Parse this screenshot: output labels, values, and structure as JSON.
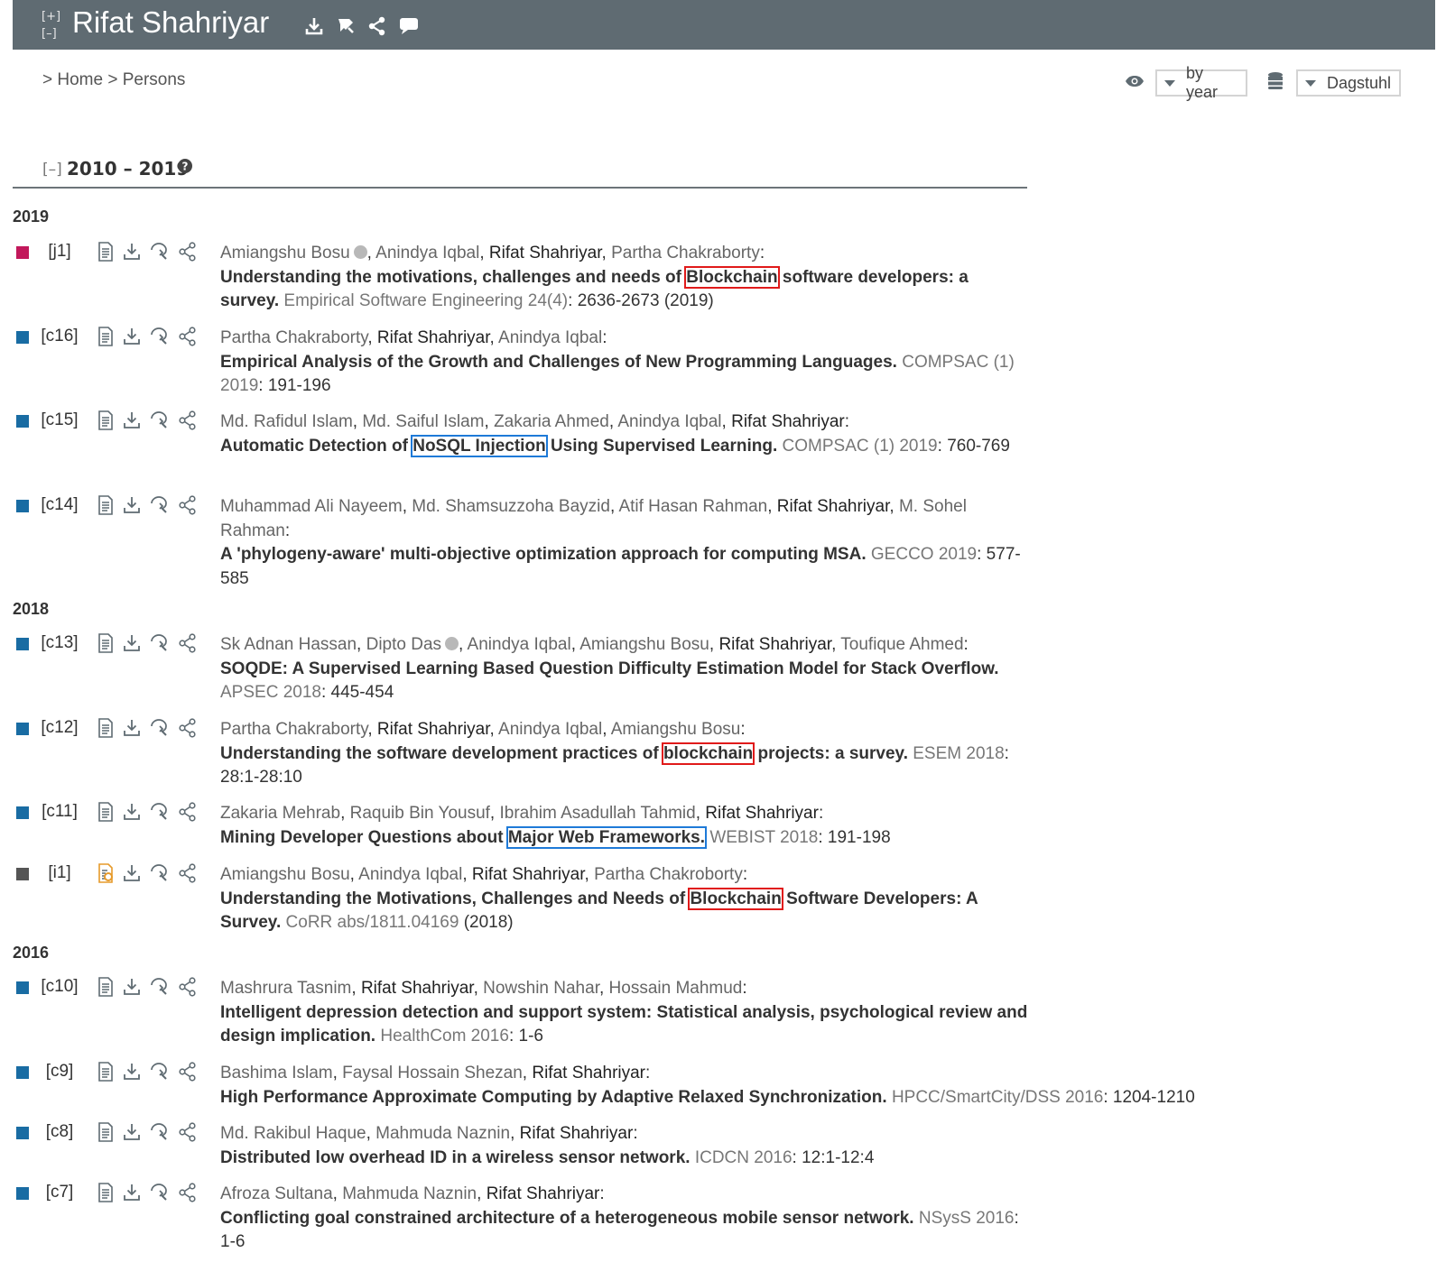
{
  "header": {
    "expand_label": "[+]",
    "collapse_label": "[–]",
    "title": "Rifat Shahriyar",
    "bg_color": "#5f6b72"
  },
  "breadcrumb": {
    "text": "> Home > Persons"
  },
  "controls": {
    "view_mode": "by year",
    "mirror": "Dagstuhl"
  },
  "section": {
    "toggle": "[–]",
    "label": "2010 – 2019"
  },
  "venue_colors": {
    "journal": "#c2185b",
    "conference": "#196ca3",
    "informal": "#555555"
  },
  "years": [
    {
      "year": "2019",
      "entries": [
        {
          "key": "[j1]",
          "type": "journal",
          "authors": [
            {
              "name": "Amiangshu Bosu",
              "me": false,
              "orcid": true
            },
            {
              "name": "Anindya Iqbal",
              "me": false
            },
            {
              "name": "Rifat Shahriyar",
              "me": true
            },
            {
              "name": "Partha Chakraborty",
              "me": false
            }
          ],
          "title_pre": "Understanding the motivations, challenges and needs of ",
          "title_hl": "Blockchain",
          "hl": "red",
          "title_post": " software developers: a survey.",
          "venue": "Empirical Software Engineering 24(4)",
          "pages": ": 2636-2673 (2019)"
        },
        {
          "key": "[c16]",
          "type": "conference",
          "authors": [
            {
              "name": "Partha Chakraborty",
              "me": false
            },
            {
              "name": "Rifat Shahriyar",
              "me": true
            },
            {
              "name": "Anindya Iqbal",
              "me": false
            }
          ],
          "title_pre": "Empirical Analysis of the Growth and Challenges of New Programming Languages.",
          "title_hl": "",
          "hl": "",
          "title_post": "",
          "venue": "COMPSAC (1) 2019",
          "pages": ": 191-196"
        },
        {
          "key": "[c15]",
          "type": "conference",
          "authors": [
            {
              "name": "Md. Rafidul Islam",
              "me": false
            },
            {
              "name": "Md. Saiful Islam",
              "me": false
            },
            {
              "name": "Zakaria Ahmed",
              "me": false
            },
            {
              "name": "Anindya Iqbal",
              "me": false
            },
            {
              "name": "Rifat Shahriyar",
              "me": true
            }
          ],
          "title_pre": "Automatic Detection of ",
          "title_hl": "NoSQL Injection",
          "hl": "blue",
          "title_post": " Using Supervised Learning.",
          "venue": "COMPSAC (1) 2019",
          "pages": ": 760-769"
        },
        {
          "key": "[c14]",
          "type": "conference",
          "authors": [
            {
              "name": "Muhammad Ali Nayeem",
              "me": false
            },
            {
              "name": "Md. Shamsuzzoha Bayzid",
              "me": false
            },
            {
              "name": "Atif Hasan Rahman",
              "me": false
            },
            {
              "name": "Rifat Shahriyar",
              "me": true
            },
            {
              "name": "M. Sohel Rahman",
              "me": false
            }
          ],
          "title_pre": "A 'phylogeny-aware' multi-objective optimization approach for computing MSA.",
          "title_hl": "",
          "hl": "",
          "title_post": "",
          "venue": "GECCO 2019",
          "pages": ": 577-585"
        }
      ]
    },
    {
      "year": "2018",
      "entries": [
        {
          "key": "[c13]",
          "type": "conference",
          "authors": [
            {
              "name": "Sk Adnan Hassan",
              "me": false
            },
            {
              "name": "Dipto Das",
              "me": false,
              "orcid": true
            },
            {
              "name": "Anindya Iqbal",
              "me": false
            },
            {
              "name": "Amiangshu Bosu",
              "me": false
            },
            {
              "name": "Rifat Shahriyar",
              "me": true
            },
            {
              "name": "Toufique Ahmed",
              "me": false
            }
          ],
          "title_pre": "SOQDE: A Supervised Learning Based Question Difficulty Estimation Model for Stack Overflow.",
          "title_hl": "",
          "hl": "",
          "title_post": "",
          "venue": "APSEC 2018",
          "pages": ": 445-454"
        },
        {
          "key": "[c12]",
          "type": "conference",
          "authors": [
            {
              "name": "Partha Chakraborty",
              "me": false
            },
            {
              "name": "Rifat Shahriyar",
              "me": true
            },
            {
              "name": "Anindya Iqbal",
              "me": false
            },
            {
              "name": "Amiangshu Bosu",
              "me": false
            }
          ],
          "title_pre": "Understanding the software development practices of ",
          "title_hl": "blockchain",
          "hl": "red",
          "title_post": " projects: a survey.",
          "venue": "ESEM 2018",
          "pages": ": 28:1-28:10"
        },
        {
          "key": "[c11]",
          "type": "conference",
          "authors": [
            {
              "name": "Zakaria Mehrab",
              "me": false
            },
            {
              "name": "Raquib Bin Yousuf",
              "me": false
            },
            {
              "name": "Ibrahim Asadullah Tahmid",
              "me": false
            },
            {
              "name": "Rifat Shahriyar",
              "me": true
            }
          ],
          "title_pre": "Mining Developer Questions about ",
          "title_hl": "Major Web Frameworks.",
          "hl": "blue",
          "title_post": "",
          "venue": "WEBIST 2018",
          "pages": ": 191-198"
        },
        {
          "key": "[i1]",
          "type": "informal",
          "authors": [
            {
              "name": "Amiangshu Bosu",
              "me": false
            },
            {
              "name": "Anindya Iqbal",
              "me": false
            },
            {
              "name": "Rifat Shahriyar",
              "me": true
            },
            {
              "name": "Partha Chakroborty",
              "me": false
            }
          ],
          "title_pre": "Understanding the Motivations, Challenges and Needs of ",
          "title_hl": "Blockchain",
          "hl": "red",
          "title_post": " Software Developers: A Survey.",
          "venue": "CoRR abs/1811.04169",
          "pages": " (2018)"
        }
      ]
    },
    {
      "year": "2016",
      "entries": [
        {
          "key": "[c10]",
          "type": "conference",
          "authors": [
            {
              "name": "Mashrura Tasnim",
              "me": false
            },
            {
              "name": "Rifat Shahriyar",
              "me": true
            },
            {
              "name": "Nowshin Nahar",
              "me": false
            },
            {
              "name": "Hossain Mahmud",
              "me": false
            }
          ],
          "title_pre": "Intelligent depression detection and support system: Statistical analysis, psychological review and design implication.",
          "title_hl": "",
          "hl": "",
          "title_post": "",
          "venue": "HealthCom 2016",
          "pages": ": 1-6"
        },
        {
          "key": "[c9]",
          "type": "conference",
          "authors": [
            {
              "name": "Bashima Islam",
              "me": false
            },
            {
              "name": "Faysal Hossain Shezan",
              "me": false
            },
            {
              "name": "Rifat Shahriyar",
              "me": true
            }
          ],
          "title_pre": "High Performance Approximate Computing by Adaptive Relaxed Synchronization.",
          "title_hl": "",
          "hl": "",
          "title_post": "",
          "venue": "HPCC/SmartCity/DSS 2016",
          "pages": ": 1204-1210"
        },
        {
          "key": "[c8]",
          "type": "conference",
          "authors": [
            {
              "name": "Md. Rakibul Haque",
              "me": false
            },
            {
              "name": "Mahmuda Naznin",
              "me": false
            },
            {
              "name": "Rifat Shahriyar",
              "me": true
            }
          ],
          "title_pre": "Distributed low overhead ID in a wireless sensor network.",
          "title_hl": "",
          "hl": "",
          "title_post": "",
          "venue": "ICDCN 2016",
          "pages": ": 12:1-12:4"
        },
        {
          "key": "[c7]",
          "type": "conference",
          "authors": [
            {
              "name": "Afroza Sultana",
              "me": false
            },
            {
              "name": "Mahmuda Naznin",
              "me": false
            },
            {
              "name": "Rifat Shahriyar",
              "me": true
            }
          ],
          "title_pre": "Conflicting goal constrained architecture of a heterogeneous mobile sensor network.",
          "title_hl": "",
          "hl": "",
          "title_post": "",
          "venue": "NSysS 2016",
          "pages": ": 1-6"
        }
      ]
    }
  ]
}
